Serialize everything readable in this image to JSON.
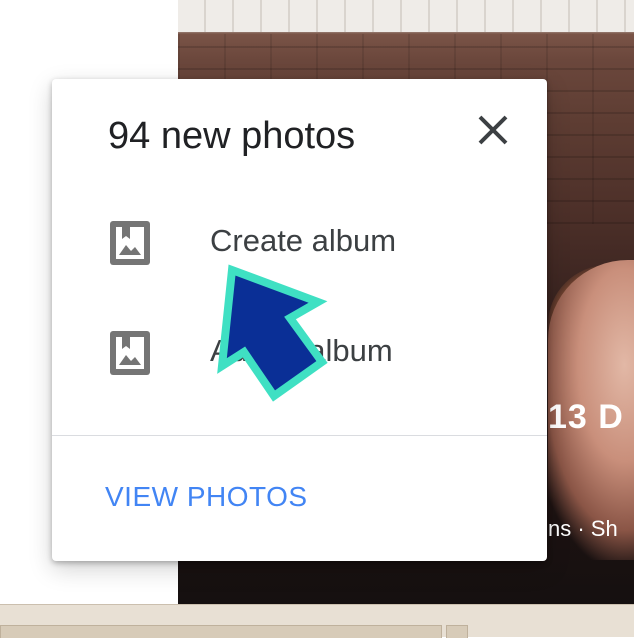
{
  "background": {
    "overlay_title": "13 D",
    "overlay_meta": "ns · Sh"
  },
  "dialog": {
    "title": "94 new photos",
    "close_icon": "close-icon",
    "items": [
      {
        "label": "Create album",
        "icon": "photo-album-icon"
      },
      {
        "label": "Add to album",
        "icon": "photo-album-icon"
      }
    ],
    "view_photos_label": "VIEW PHOTOS"
  },
  "colors": {
    "accent": "#4285f4",
    "arrow_fill": "#0a2f96",
    "arrow_stroke": "#3fe0c3",
    "icon_gray": "#757575"
  }
}
